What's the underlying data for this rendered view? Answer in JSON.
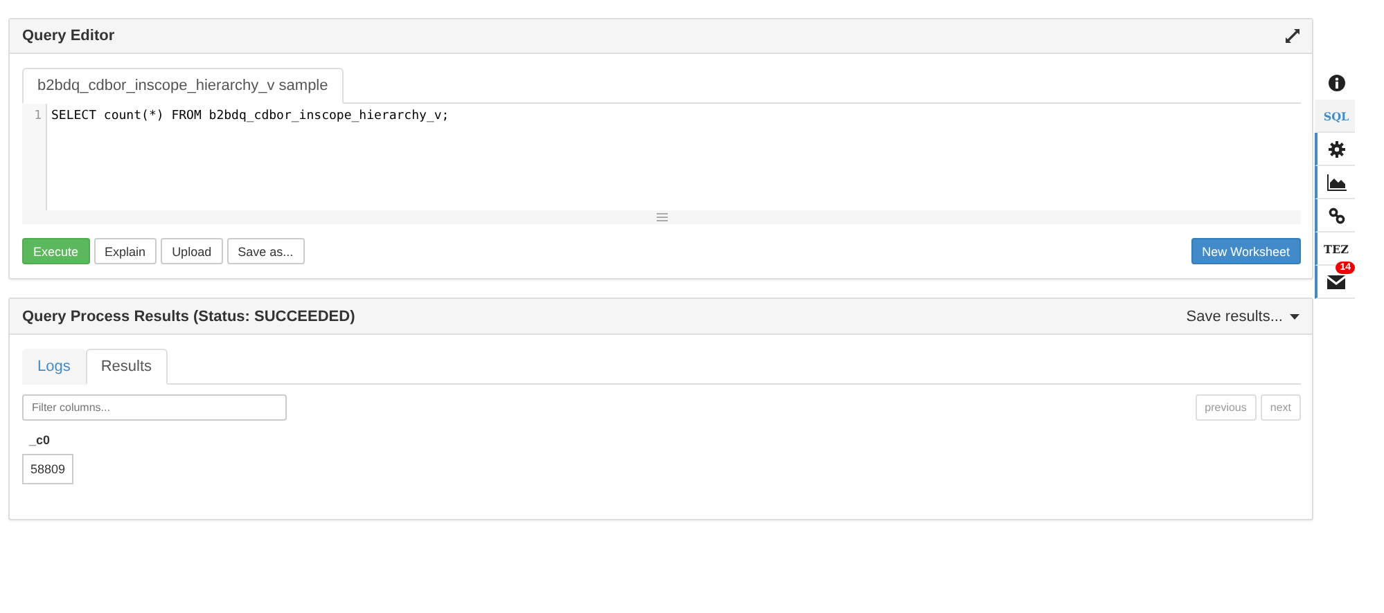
{
  "editor_panel": {
    "title": "Query Editor",
    "tabs": [
      {
        "label": "b2bdq_cdbor_inscope_hierarchy_v sample",
        "selected": true
      }
    ],
    "lines": [
      {
        "number": "1",
        "code": "SELECT count(*) FROM b2bdq_cdbor_inscope_hierarchy_v;"
      }
    ],
    "buttons": [
      {
        "label": "Execute",
        "kind": "primary"
      },
      {
        "label": "Explain",
        "kind": "default"
      },
      {
        "label": "Upload",
        "kind": "default"
      },
      {
        "label": "Save as...",
        "kind": "default"
      }
    ],
    "new_worksheet": "New Worksheet"
  },
  "results_panel": {
    "title": "Query Process Results (Status: SUCCEEDED)",
    "save_menu": "Save results...",
    "tabs": [
      {
        "label": "Logs",
        "selected": false
      },
      {
        "label": "Results",
        "selected": true
      }
    ],
    "filter": {
      "placeholder": "Filter columns..."
    },
    "pager": [
      "previous",
      "next"
    ],
    "columns": [
      "_c0"
    ],
    "rows": [
      [
        "58809"
      ]
    ]
  },
  "sidebar": {
    "items": [
      {
        "kind": "info",
        "selected": false
      },
      {
        "kind": "text",
        "label": "SQL",
        "selected": true
      },
      {
        "kind": "gear",
        "selected": false
      },
      {
        "kind": "chart",
        "selected": false
      },
      {
        "kind": "link",
        "selected": false
      },
      {
        "kind": "text",
        "label": "TEZ",
        "selected": false
      },
      {
        "kind": "mail",
        "badge": "14",
        "selected": false
      }
    ]
  }
}
